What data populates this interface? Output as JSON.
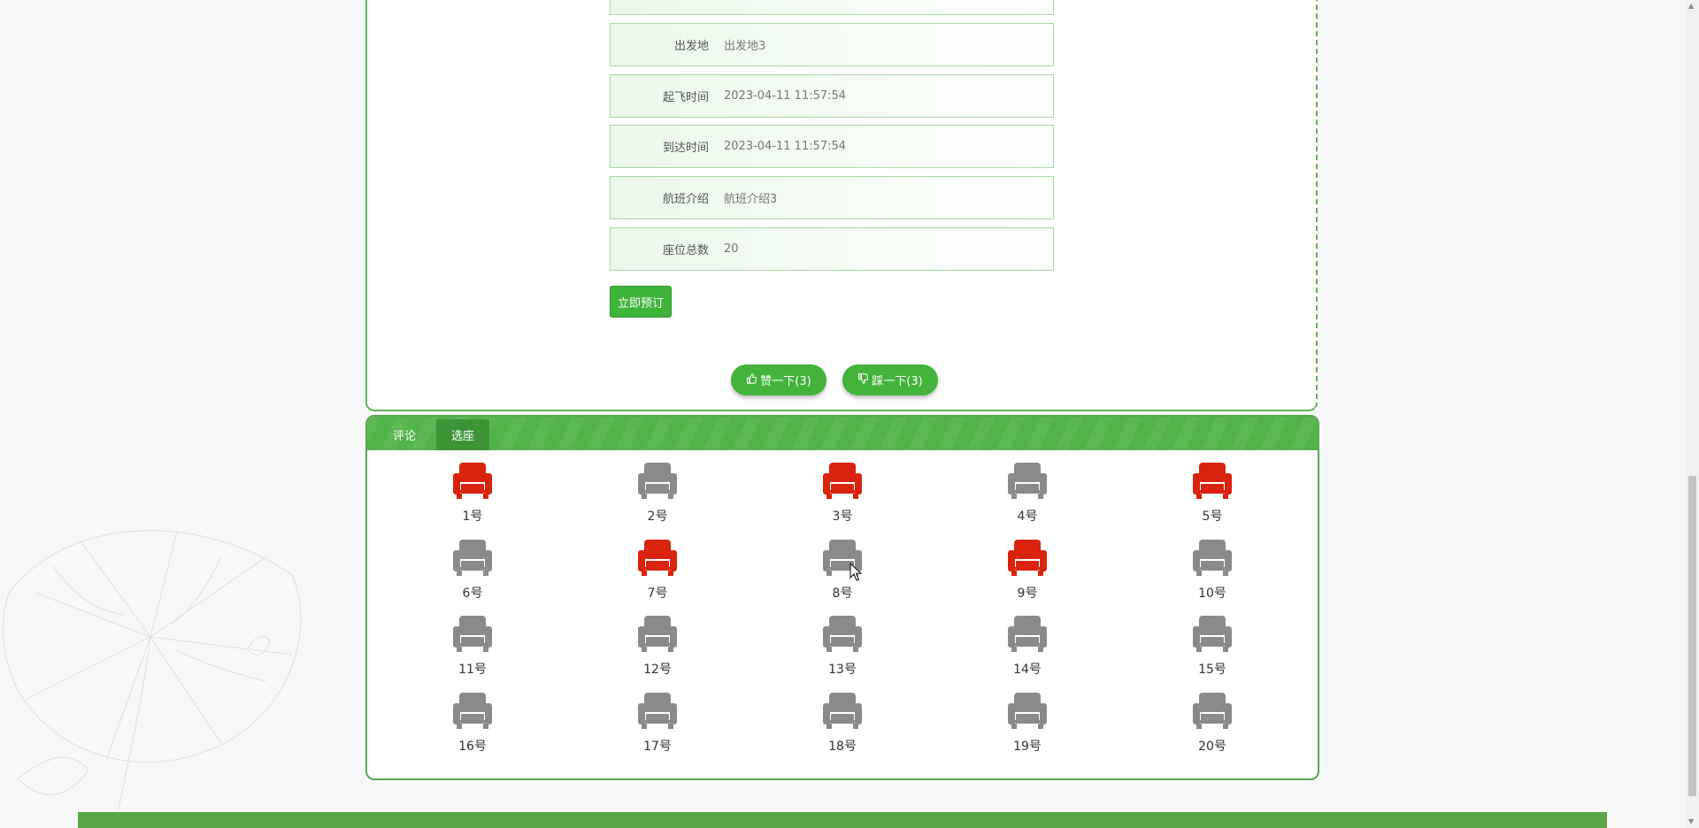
{
  "flight_details": {
    "fields": [
      {
        "label": "出发地",
        "value": "出发地3"
      },
      {
        "label": "起飞时间",
        "value": "2023-04-11 11:57:54"
      },
      {
        "label": "到达时间",
        "value": "2023-04-11 11:57:54"
      },
      {
        "label": "航班介绍",
        "value": "航班介绍3"
      },
      {
        "label": "座位总数",
        "value": "20"
      }
    ],
    "book_button": "立即预订"
  },
  "votes": {
    "like_label": "赞一下(3)",
    "dislike_label": "踩一下(3)"
  },
  "tabs": [
    {
      "label": "评论",
      "active": false
    },
    {
      "label": "选座",
      "active": true
    }
  ],
  "seats": [
    {
      "label": "1号",
      "taken": true
    },
    {
      "label": "2号",
      "taken": false
    },
    {
      "label": "3号",
      "taken": true
    },
    {
      "label": "4号",
      "taken": false
    },
    {
      "label": "5号",
      "taken": true
    },
    {
      "label": "6号",
      "taken": false
    },
    {
      "label": "7号",
      "taken": true
    },
    {
      "label": "8号",
      "taken": false
    },
    {
      "label": "9号",
      "taken": true
    },
    {
      "label": "10号",
      "taken": false
    },
    {
      "label": "11号",
      "taken": false
    },
    {
      "label": "12号",
      "taken": false
    },
    {
      "label": "13号",
      "taken": false
    },
    {
      "label": "14号",
      "taken": false
    },
    {
      "label": "15号",
      "taken": false
    },
    {
      "label": "16号",
      "taken": false
    },
    {
      "label": "17号",
      "taken": false
    },
    {
      "label": "18号",
      "taken": false
    },
    {
      "label": "19号",
      "taken": false
    },
    {
      "label": "20号",
      "taken": false
    }
  ],
  "icons": {
    "like": "thumbs-up-icon",
    "dislike": "thumbs-down-icon",
    "seat": "armchair-icon"
  },
  "colors": {
    "brand_green": "#43b33c",
    "seat_taken": "#d9230f",
    "seat_available": "#8a8a8a"
  }
}
